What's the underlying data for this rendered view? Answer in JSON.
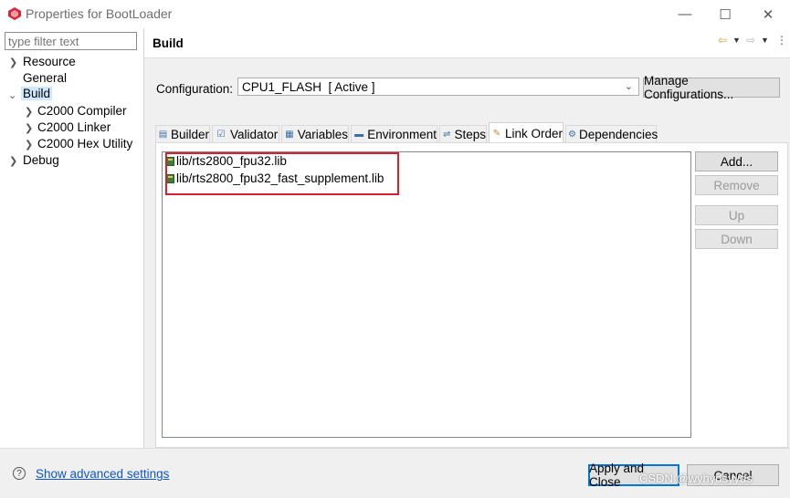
{
  "window": {
    "title": "Properties for BootLoader",
    "minimize_glyph": "—",
    "maximize_glyph": "☐",
    "close_glyph": "✕"
  },
  "sidebar": {
    "filter_placeholder": "type filter text",
    "items": [
      {
        "label": "Resource",
        "expandable": true,
        "expanded": false
      },
      {
        "label": "General",
        "expandable": false
      },
      {
        "label": "Build",
        "expandable": true,
        "expanded": true,
        "selected": true
      },
      {
        "label": "C2000 Compiler",
        "expandable": true,
        "expanded": false
      },
      {
        "label": "C2000 Linker",
        "expandable": true,
        "expanded": false
      },
      {
        "label": "C2000 Hex Utility",
        "expandable": true,
        "expanded": false
      },
      {
        "label": "Debug",
        "expandable": true,
        "expanded": false
      }
    ]
  },
  "page": {
    "title": "Build",
    "configuration_label": "Configuration:",
    "configuration_value": "CPU1_FLASH  [ Active ]",
    "manage_button": "Manage Configurations..."
  },
  "tabs": [
    {
      "label": "Builder",
      "icon": "builder-icon",
      "active": false
    },
    {
      "label": "Validator",
      "icon": "validator-icon",
      "active": false
    },
    {
      "label": "Variables",
      "icon": "variables-icon",
      "active": false
    },
    {
      "label": "Environment",
      "icon": "environment-icon",
      "active": false
    },
    {
      "label": "Steps",
      "icon": "steps-icon",
      "active": false
    },
    {
      "label": "Link Order",
      "icon": "link-order-icon",
      "active": true
    },
    {
      "label": "Dependencies",
      "icon": "dependencies-icon",
      "active": false
    }
  ],
  "link_order": {
    "files": [
      "lib/rts2800_fpu32.lib",
      "lib/rts2800_fpu32_fast_supplement.lib"
    ],
    "buttons": {
      "add": "Add...",
      "remove": "Remove",
      "up": "Up",
      "down": "Down"
    }
  },
  "footer": {
    "advanced_link": "Show advanced settings",
    "apply_close": "Apply and Close",
    "cancel": "Cancel",
    "watermark": "CSDN @wyhydsyyds"
  },
  "colors": {
    "highlight_box": "#d9202e",
    "link": "#1155cc"
  }
}
